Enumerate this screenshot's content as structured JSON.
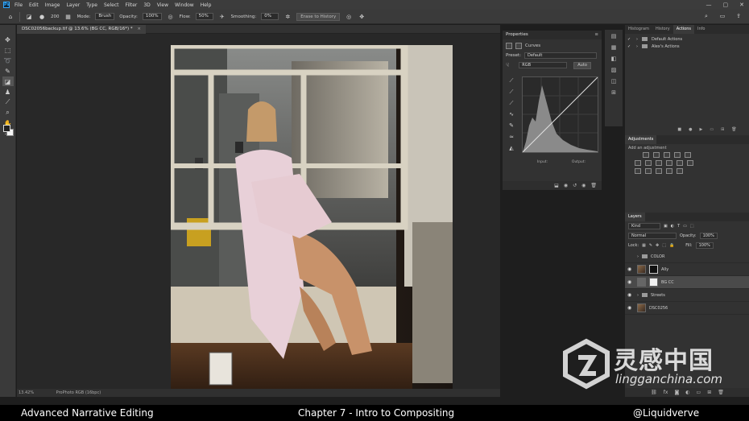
{
  "menubar": {
    "logo": "Ps",
    "items": [
      "File",
      "Edit",
      "Image",
      "Layer",
      "Type",
      "Select",
      "Filter",
      "3D",
      "View",
      "Window",
      "Help"
    ]
  },
  "options": {
    "mode_label": "Mode:",
    "mode_value": "Brush",
    "opacity_label": "Opacity:",
    "opacity_value": "100%",
    "flow_label": "Flow:",
    "flow_value": "50%",
    "smoothing_label": "Smoothing:",
    "smoothing_value": "0%",
    "brush_size": "200",
    "erase_history_label": "Erase to History"
  },
  "document": {
    "tab_title": "DSC02056backup.tif @ 13.6% (BG CC, RGB/16*) *",
    "close_glyph": "×",
    "zoom": "13.42%",
    "profile": "ProPhoto RGB (16bpc)"
  },
  "properties": {
    "panel_title": "Properties",
    "header_label": "Curves",
    "preset_label": "Preset:",
    "preset_value": "Default",
    "channel_value": "RGB",
    "auto_label": "Auto",
    "input_label": "Input:",
    "output_label": "Output:"
  },
  "actions_panel": {
    "tabs": [
      "Histogram",
      "History",
      "Actions",
      "Info"
    ],
    "items": [
      "Default Actions",
      "Alex's Actions"
    ]
  },
  "adjustments": {
    "title": "Adjustments",
    "subtitle": "Add an adjustment"
  },
  "layers": {
    "title": "Layers",
    "kind_label": "Kind",
    "blend_mode": "Normal",
    "opacity_label": "Opacity:",
    "opacity_value": "100%",
    "lock_label": "Lock:",
    "fill_label": "Fill:",
    "fill_value": "100%",
    "rows": [
      {
        "name": "COLOR"
      },
      {
        "name": "Ally"
      },
      {
        "name": "BG CC"
      },
      {
        "name": "Streets"
      },
      {
        "name": "DSC0256"
      }
    ]
  },
  "watermark": {
    "chinese": "灵感中国",
    "site": "lingganchina.com"
  },
  "caption": {
    "left": "Advanced Narrative Editing",
    "center": "Chapter 7 - Intro to Compositing",
    "right": "@Liquidverve"
  }
}
